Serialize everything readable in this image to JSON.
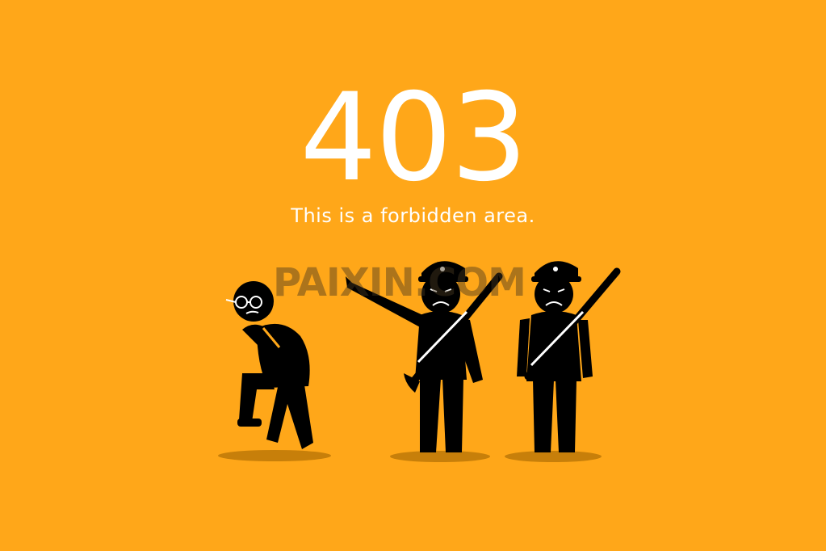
{
  "error": {
    "code": "403",
    "message": "This is a forbidden area."
  },
  "watermark": {
    "text": "PAIXIN.COM"
  },
  "illustration": {
    "figures": [
      "intruder-figure",
      "pointing-guard-figure",
      "standing-guard-figure"
    ]
  },
  "colors": {
    "background": "#ffa719",
    "text": "#ffffff",
    "figure": "#000000",
    "shadow": "#c77f0a"
  }
}
